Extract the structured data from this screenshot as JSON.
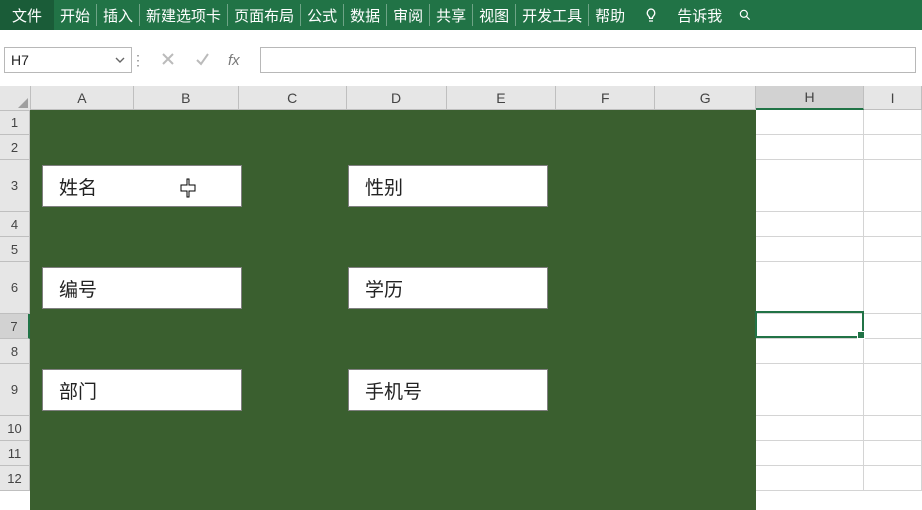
{
  "ribbon": {
    "tabs": [
      "文件",
      "开始",
      "插入",
      "新建选项卡",
      "页面布局",
      "公式",
      "数据",
      "审阅",
      "共享",
      "视图",
      "开发工具",
      "帮助"
    ],
    "tellme": "告诉我"
  },
  "namebox": {
    "value": "H7"
  },
  "formula_bar": {
    "fx_label": "fx",
    "value": ""
  },
  "columns": [
    "A",
    "B",
    "C",
    "D",
    "E",
    "F",
    "G",
    "H",
    "I"
  ],
  "active_column": "H",
  "rows": [
    "1",
    "2",
    "3",
    "4",
    "5",
    "6",
    "7",
    "8",
    "9",
    "10",
    "11",
    "12"
  ],
  "tall_rows": [
    "3",
    "6",
    "9"
  ],
  "active_row": "7",
  "labels": {
    "name": "姓名",
    "gender": "性别",
    "id": "编号",
    "education": "学历",
    "department": "部门",
    "phone": "手机号"
  },
  "selection": {
    "cell": "H7"
  }
}
